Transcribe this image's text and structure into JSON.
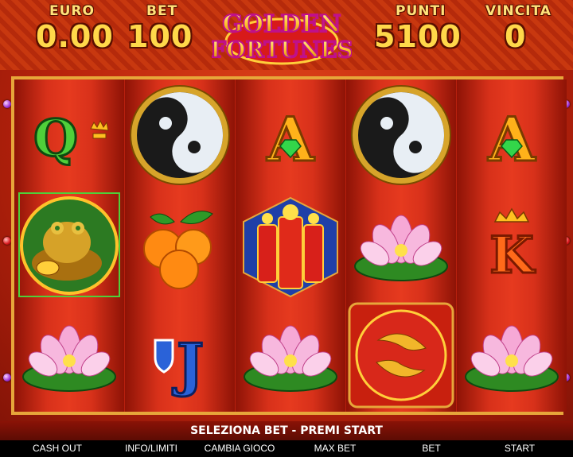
{
  "header": {
    "euro_label": "EURO",
    "euro_value": "0.00",
    "bet_label": "BET",
    "bet_value": "100",
    "points_label": "PUNTI",
    "points_value": "5100",
    "win_label": "VINCITA",
    "win_value": "0",
    "logo_line1": "GOLDEN",
    "logo_line2": "FORTUNES"
  },
  "reels": [
    {
      "symbols": [
        "queen",
        "golden-toad",
        "lotus-flower"
      ],
      "letters": [
        "Q",
        "",
        ""
      ]
    },
    {
      "symbols": [
        "yin-yang",
        "tangerines",
        "jack"
      ],
      "letters": [
        "",
        "",
        "J"
      ]
    },
    {
      "symbols": [
        "ace",
        "firecrackers",
        "lotus-flower"
      ],
      "letters": [
        "A",
        "",
        ""
      ]
    },
    {
      "symbols": [
        "yin-yang",
        "lotus-flower",
        "golden-koi"
      ],
      "letters": [
        "",
        "",
        ""
      ]
    },
    {
      "symbols": [
        "ace",
        "king",
        "lotus-flower"
      ],
      "letters": [
        "A",
        "K",
        ""
      ]
    }
  ],
  "message": "SELEZIONA BET - PREMI START",
  "buttons": [
    {
      "label": "CASH OUT"
    },
    {
      "label": "INFO/LIMITI"
    },
    {
      "label": "CAMBIA GIOCO"
    },
    {
      "label": "MAX BET"
    },
    {
      "label": "BET"
    },
    {
      "label": "START"
    }
  ],
  "colors": {
    "accent_gold": "#ffd84a",
    "background_red": "#d8311a",
    "frame_gold": "#e7a63a"
  }
}
